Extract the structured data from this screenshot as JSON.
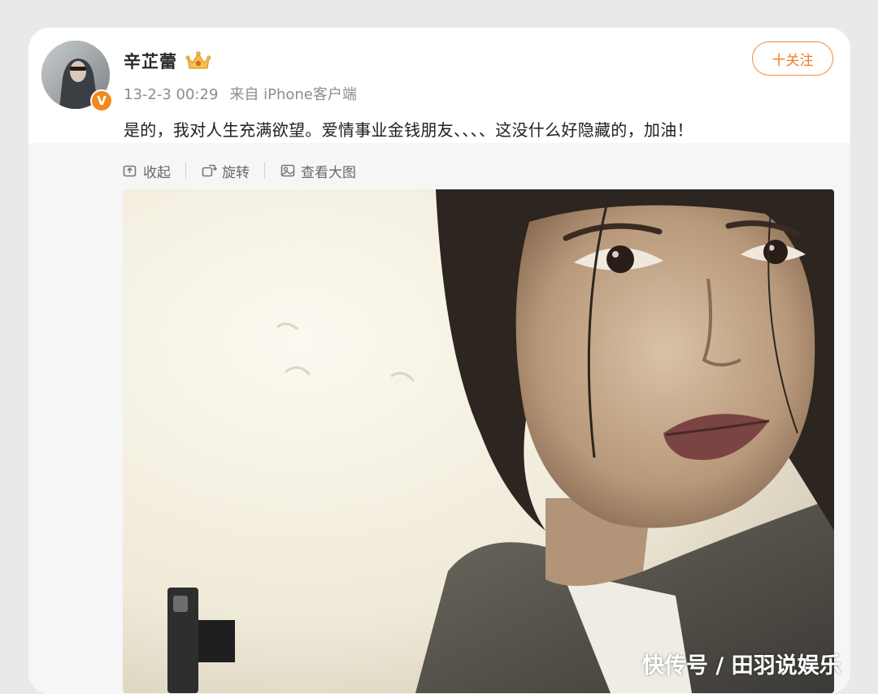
{
  "post": {
    "username": "辛芷蕾",
    "timestamp": "13-2-3 00:29",
    "source": "来自 iPhone客户端",
    "text": "是的，我对人生充满欲望。爱情事业金钱朋友、、、、这没什么好隐藏的，加油！",
    "follow_label": "十关注",
    "verified_badge": "V"
  },
  "toolbar": {
    "collapse_label": "收起",
    "rotate_label": "旋转",
    "view_large_label": "查看大图"
  },
  "watermark": "快传号 / 田羽说娱乐",
  "colors": {
    "accent": "#f07b27",
    "badge": "#f28a1e",
    "text_primary": "#1f1f1f",
    "text_secondary": "#8d8d8d"
  },
  "icons": {
    "crown": "crown-icon",
    "collapse": "collapse-icon",
    "rotate": "rotate-icon",
    "view_large": "image-view-icon"
  }
}
